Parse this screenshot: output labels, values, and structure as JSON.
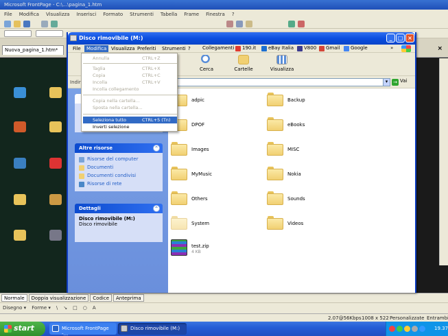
{
  "background_app": {
    "title": "Microsoft FrontPage - C:\\...\\pagina_1.htm",
    "menu": [
      "File",
      "Modifica",
      "Visualizza",
      "Inserisci",
      "Formato",
      "Strumenti",
      "Tabella",
      "Frame",
      "Finestra",
      "?"
    ],
    "doc_tab": "Nuova_pagina_1.htm*",
    "view_tabs": [
      "Normale",
      "Doppia visualizzazione",
      "Codice",
      "Anteprima"
    ],
    "draw_bar": [
      "Disegno ▾",
      "Forme ▾"
    ],
    "status": {
      "speed": "2.07@56Kbps",
      "size": "1008 x 522",
      "mode": "Personalizzate",
      "status": "Entrambi"
    }
  },
  "taskbar": {
    "start": "start",
    "tasks": [
      "Microsoft FrontPage -...",
      "Disco rimovibile (M:)"
    ],
    "clock": "19.37"
  },
  "explorer": {
    "title": "Disco rimovibile (M:)",
    "menu": [
      "File",
      "Modifica",
      "Visualizza",
      "Preferiti",
      "Strumenti",
      "?"
    ],
    "links": [
      {
        "label": "Collegamenti",
        "color": ""
      },
      {
        "label": "190.it",
        "color": "#e03a2f"
      },
      {
        "label": "eBay Italia",
        "color": "#1b6fd1"
      },
      {
        "label": "V800",
        "color": "#3b3b8f"
      },
      {
        "label": "Gmail",
        "color": "#d44638"
      },
      {
        "label": "Google",
        "color": "#4285f4"
      }
    ],
    "toolbar": [
      "Cerca",
      "Cartelle",
      "Visualizza"
    ],
    "address_label": "Indirizzo",
    "go_label": "Vai",
    "edit_menu": [
      {
        "label": "Annulla",
        "shortcut": "CTRL+Z",
        "enabled": false
      },
      {
        "sep": true
      },
      {
        "label": "Taglia",
        "shortcut": "CTRL+X",
        "enabled": false
      },
      {
        "label": "Copia",
        "shortcut": "CTRL+C",
        "enabled": false
      },
      {
        "label": "Incolla",
        "shortcut": "CTRL+V",
        "enabled": false
      },
      {
        "label": "Incolla collegamento",
        "shortcut": "",
        "enabled": false
      },
      {
        "sep": true
      },
      {
        "label": "Copia nella cartella...",
        "shortcut": "",
        "enabled": false
      },
      {
        "label": "Sposta nella cartella...",
        "shortcut": "",
        "enabled": false
      },
      {
        "sep": true
      },
      {
        "label": "Seleziona tutto",
        "shortcut": "CTRL+5 (Tn)",
        "enabled": true,
        "highlighted": true
      },
      {
        "label": "Inverti selezione",
        "shortcut": "",
        "enabled": true
      }
    ],
    "other_places": {
      "title": "Altre risorse",
      "items": [
        {
          "label": "Risorse del computer",
          "icon": "computer-icon"
        },
        {
          "label": "Documenti",
          "icon": "folder-icon"
        },
        {
          "label": "Documenti condivisi",
          "icon": "folder-icon"
        },
        {
          "label": "Risorse di rete",
          "icon": "network-icon"
        }
      ]
    },
    "details": {
      "title": "Dettagli",
      "name": "Disco rimovibile (M:)",
      "type": "Disco rimovibile"
    },
    "folders_left": [
      "adpic",
      "DPOF",
      "Images",
      "MyMusic",
      "Others",
      "System"
    ],
    "folders_right": [
      "Backup",
      "eBooks",
      "MISC",
      "Nokia",
      "Sounds",
      "Videos"
    ],
    "file": {
      "name": "test.zip",
      "size": "4 KB"
    }
  }
}
